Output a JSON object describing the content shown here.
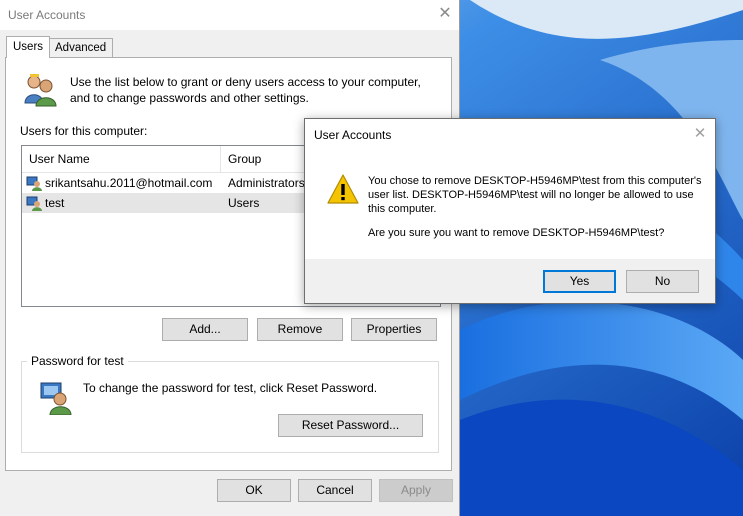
{
  "main_window": {
    "title": "User Accounts",
    "close_glyph": "✕",
    "tabs": [
      {
        "label": "Users",
        "active": true
      },
      {
        "label": "Advanced",
        "active": false
      }
    ],
    "intro_text": "Use the list below to grant or deny users access to your computer, and to change passwords and other settings.",
    "users_label": "Users for this computer:",
    "columns": [
      "User Name",
      "Group"
    ],
    "users": [
      {
        "name": "srikantsahu.2011@hotmail.com",
        "group": "Administrators"
      },
      {
        "name": "test",
        "group": "Users",
        "selected": true
      }
    ],
    "list_buttons": {
      "add": "Add...",
      "remove": "Remove",
      "properties": "Properties"
    },
    "password_group": {
      "label": "Password for test",
      "text": "To change the password for test, click Reset Password.",
      "reset_button": "Reset Password..."
    },
    "footer_buttons": {
      "ok": "OK",
      "cancel": "Cancel",
      "apply": "Apply"
    }
  },
  "dialog": {
    "title": "User Accounts",
    "close_glyph": "✕",
    "message": "You chose to remove DESKTOP-H5946MP\\test from this computer's user list. DESKTOP-H5946MP\\test will no longer be allowed to use this computer.",
    "question": "Are you sure you want to remove DESKTOP-H5946MP\\test?",
    "yes": "Yes",
    "no": "No"
  },
  "colors": {
    "wallpaper_blue": "#0d5fd3",
    "accent": "#0078d7",
    "warning_yellow": "#f5c400"
  }
}
